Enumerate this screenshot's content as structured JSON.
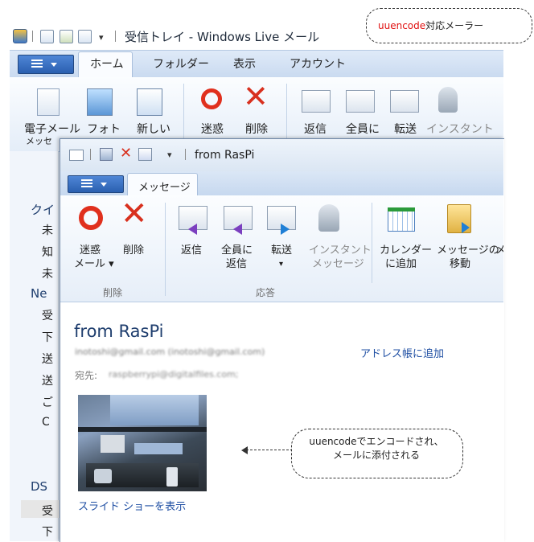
{
  "callouts": {
    "top_red": "uuencode",
    "top_rest": "対応メーラー",
    "mid_line1": "uuencodeでエンコードされ、",
    "mid_line2": "メールに添付される"
  },
  "back_window": {
    "title": "受信トレイ - Windows Live メール",
    "tabs": [
      "ホーム",
      "フォルダー",
      "表示",
      "アカウント"
    ],
    "ribbon": {
      "new_email": "電子メール",
      "new_email_sub": "メッセ",
      "photo": "フォト",
      "new": "新しい",
      "junk": "迷惑",
      "delete": "削除",
      "reply": "返信",
      "reply_all": "全員に",
      "forward": "転送",
      "instant": "インスタント"
    },
    "nav": {
      "quick_views": "クイ",
      "items1": [
        "未",
        "知",
        "未"
      ],
      "newsgroup": "Ne",
      "items2": [
        "受",
        "下",
        "送",
        "送",
        "ご",
        "C"
      ],
      "ds": "DS",
      "items3": [
        "受",
        "下"
      ]
    }
  },
  "front_window": {
    "title": "from RasPi",
    "tab": "メッセージ",
    "ribbon": {
      "junk_line1": "迷惑",
      "junk_line2": "メール ▾",
      "delete": "削除",
      "reply": "返信",
      "reply_all_line1": "全員に",
      "reply_all_line2": "返信",
      "forward": "転送",
      "forward_arrow": "▾",
      "instant_line1": "インスタント",
      "instant_line2": "メッセージ",
      "calendar_line1": "カレンダー",
      "calendar_line2": "に追加",
      "move_line1": "メッセージの",
      "move_line2": "移動",
      "more": "メ",
      "group_delete": "削除",
      "group_respond": "応答"
    },
    "message": {
      "subject": "from RasPi",
      "from": "inotoshi@gmail.com (inotoshi@gmail.com)",
      "add_contact": "アドレス帳に追加",
      "to_label": "宛先:",
      "to_value": "raspberrypi@digitalfiles.com;",
      "slideshow": "スライド ショーを表示"
    }
  },
  "colors": {
    "accent": "#2a5fb0",
    "link": "#1f4fa3",
    "subject": "#1f3e6e",
    "callout_red": "#e01010"
  }
}
